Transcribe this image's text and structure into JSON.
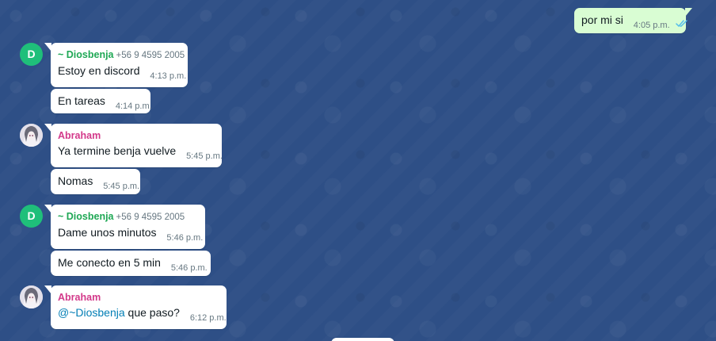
{
  "messages": [
    {
      "direction": "out",
      "text": "por mi si",
      "time": "4:05 p.m.",
      "status_icon": "double-check-read-icon"
    },
    {
      "direction": "in",
      "avatar_letter": "D",
      "sender": "~ Diosbenja",
      "phone": "+56 9 4595 2005",
      "text": "Estoy en discord",
      "time": "4:13 p.m."
    },
    {
      "direction": "in",
      "text": "En tareas",
      "time": "4:14 p.m."
    },
    {
      "direction": "in",
      "avatar_icon": "user-photo-avatar",
      "sender": "Abraham",
      "text": "Ya termine benja vuelve",
      "time": "5:45 p.m."
    },
    {
      "direction": "in",
      "text": "Nomas",
      "time": "5:45 p.m."
    },
    {
      "direction": "in",
      "avatar_letter": "D",
      "sender": "~ Diosbenja",
      "phone": "+56 9 4595 2005",
      "text": "Dame unos minutos",
      "time": "5:46 p.m."
    },
    {
      "direction": "in",
      "text": "Me conecto en 5 min",
      "time": "5:46 p.m."
    },
    {
      "direction": "in",
      "avatar_icon": "user-photo-avatar",
      "sender": "Abraham",
      "mention": "@~Diosbenja",
      "text": " que paso?",
      "time": "6:12 p.m."
    }
  ],
  "colors": {
    "background": "#2e4f86",
    "incoming_bubble": "#ffffff",
    "outgoing_bubble": "#d9fdd3",
    "sender_diosbenja": "#1fa855",
    "sender_abraham": "#d3398a",
    "mention": "#027eb5",
    "read_ticks": "#53bdeb",
    "avatar_letter_bg": "#1fbf7a"
  }
}
